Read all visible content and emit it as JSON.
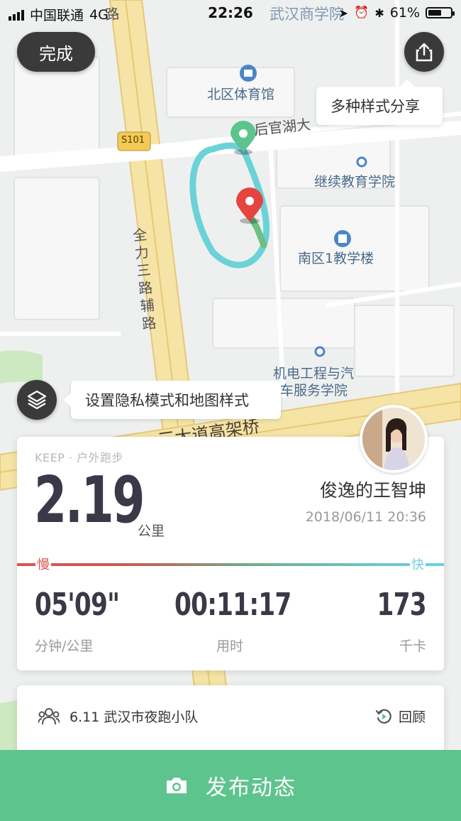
{
  "status_bar": {
    "carrier": "中国联通",
    "network": "4G",
    "time": "22:26",
    "battery": "61%",
    "battery_level": 0.61
  },
  "map": {
    "done_label": "完成",
    "share_tip": "多种样式分享",
    "privacy_tip": "设置隐私模式和地图样式",
    "pois": {
      "north_gym": "北区体育馆",
      "continuing_edu": "继续教育学院",
      "south_building": "南区1教学楼",
      "mech_school_1": "机电工程与汽",
      "mech_school_2": "车服务学院",
      "business_school": "武汉商学院"
    },
    "roads": {
      "s101": "S101",
      "houguan_lake": "后官湖大",
      "quanli": "全力三路辅路",
      "elevated": "三大道高架桥",
      "road_top": "路"
    },
    "accent_route": "#6dd1e8",
    "start_pin_color": "#5ec48e",
    "end_pin_color": "#e5443f"
  },
  "card": {
    "source": "KEEP · 户外跑步",
    "distance": "2.19",
    "distance_unit": "公里",
    "user_name": "俊逸的王智坤",
    "datetime": "2018/06/11 20:36",
    "slow_label": "慢",
    "fast_label": "快",
    "pace": "05'09\"",
    "pace_label": "分钟/公里",
    "duration": "00:11:17",
    "duration_label": "用时",
    "calories": "173",
    "calories_label": "千卡"
  },
  "team_card": {
    "team_name": "6.11 武汉市夜跑小队",
    "review_label": "回顾"
  },
  "publish_label": "发布动态",
  "icons": [
    "signal-icon",
    "battery-icon",
    "share-icon",
    "layers-icon",
    "start-pin-icon",
    "end-pin-icon",
    "group-icon",
    "replay-icon",
    "camera-icon"
  ],
  "colors": {
    "publish_bg": "#5ec48e",
    "card_text": "#3b3848"
  }
}
